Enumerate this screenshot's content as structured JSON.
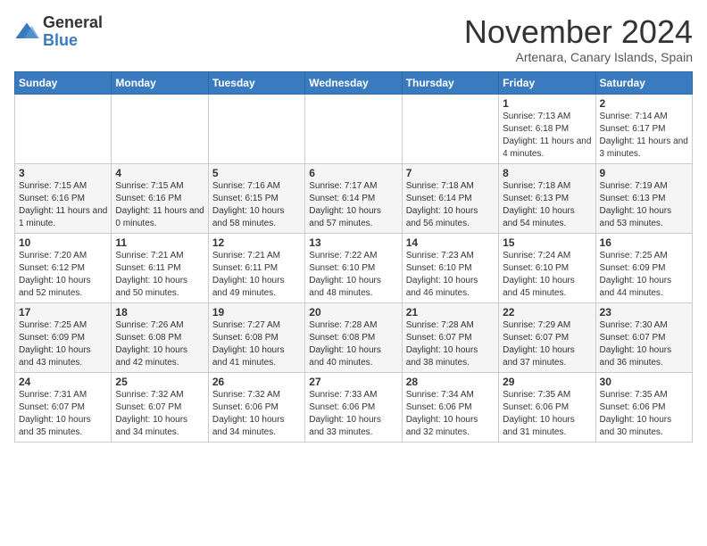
{
  "logo": {
    "general": "General",
    "blue": "Blue"
  },
  "header": {
    "month": "November 2024",
    "location": "Artenara, Canary Islands, Spain"
  },
  "weekdays": [
    "Sunday",
    "Monday",
    "Tuesday",
    "Wednesday",
    "Thursday",
    "Friday",
    "Saturday"
  ],
  "weeks": [
    [
      {
        "day": "",
        "info": ""
      },
      {
        "day": "",
        "info": ""
      },
      {
        "day": "",
        "info": ""
      },
      {
        "day": "",
        "info": ""
      },
      {
        "day": "",
        "info": ""
      },
      {
        "day": "1",
        "info": "Sunrise: 7:13 AM\nSunset: 6:18 PM\nDaylight: 11 hours and 4 minutes."
      },
      {
        "day": "2",
        "info": "Sunrise: 7:14 AM\nSunset: 6:17 PM\nDaylight: 11 hours and 3 minutes."
      }
    ],
    [
      {
        "day": "3",
        "info": "Sunrise: 7:15 AM\nSunset: 6:16 PM\nDaylight: 11 hours and 1 minute."
      },
      {
        "day": "4",
        "info": "Sunrise: 7:15 AM\nSunset: 6:16 PM\nDaylight: 11 hours and 0 minutes."
      },
      {
        "day": "5",
        "info": "Sunrise: 7:16 AM\nSunset: 6:15 PM\nDaylight: 10 hours and 58 minutes."
      },
      {
        "day": "6",
        "info": "Sunrise: 7:17 AM\nSunset: 6:14 PM\nDaylight: 10 hours and 57 minutes."
      },
      {
        "day": "7",
        "info": "Sunrise: 7:18 AM\nSunset: 6:14 PM\nDaylight: 10 hours and 56 minutes."
      },
      {
        "day": "8",
        "info": "Sunrise: 7:18 AM\nSunset: 6:13 PM\nDaylight: 10 hours and 54 minutes."
      },
      {
        "day": "9",
        "info": "Sunrise: 7:19 AM\nSunset: 6:13 PM\nDaylight: 10 hours and 53 minutes."
      }
    ],
    [
      {
        "day": "10",
        "info": "Sunrise: 7:20 AM\nSunset: 6:12 PM\nDaylight: 10 hours and 52 minutes."
      },
      {
        "day": "11",
        "info": "Sunrise: 7:21 AM\nSunset: 6:11 PM\nDaylight: 10 hours and 50 minutes."
      },
      {
        "day": "12",
        "info": "Sunrise: 7:21 AM\nSunset: 6:11 PM\nDaylight: 10 hours and 49 minutes."
      },
      {
        "day": "13",
        "info": "Sunrise: 7:22 AM\nSunset: 6:10 PM\nDaylight: 10 hours and 48 minutes."
      },
      {
        "day": "14",
        "info": "Sunrise: 7:23 AM\nSunset: 6:10 PM\nDaylight: 10 hours and 46 minutes."
      },
      {
        "day": "15",
        "info": "Sunrise: 7:24 AM\nSunset: 6:10 PM\nDaylight: 10 hours and 45 minutes."
      },
      {
        "day": "16",
        "info": "Sunrise: 7:25 AM\nSunset: 6:09 PM\nDaylight: 10 hours and 44 minutes."
      }
    ],
    [
      {
        "day": "17",
        "info": "Sunrise: 7:25 AM\nSunset: 6:09 PM\nDaylight: 10 hours and 43 minutes."
      },
      {
        "day": "18",
        "info": "Sunrise: 7:26 AM\nSunset: 6:08 PM\nDaylight: 10 hours and 42 minutes."
      },
      {
        "day": "19",
        "info": "Sunrise: 7:27 AM\nSunset: 6:08 PM\nDaylight: 10 hours and 41 minutes."
      },
      {
        "day": "20",
        "info": "Sunrise: 7:28 AM\nSunset: 6:08 PM\nDaylight: 10 hours and 40 minutes."
      },
      {
        "day": "21",
        "info": "Sunrise: 7:28 AM\nSunset: 6:07 PM\nDaylight: 10 hours and 38 minutes."
      },
      {
        "day": "22",
        "info": "Sunrise: 7:29 AM\nSunset: 6:07 PM\nDaylight: 10 hours and 37 minutes."
      },
      {
        "day": "23",
        "info": "Sunrise: 7:30 AM\nSunset: 6:07 PM\nDaylight: 10 hours and 36 minutes."
      }
    ],
    [
      {
        "day": "24",
        "info": "Sunrise: 7:31 AM\nSunset: 6:07 PM\nDaylight: 10 hours and 35 minutes."
      },
      {
        "day": "25",
        "info": "Sunrise: 7:32 AM\nSunset: 6:07 PM\nDaylight: 10 hours and 34 minutes."
      },
      {
        "day": "26",
        "info": "Sunrise: 7:32 AM\nSunset: 6:06 PM\nDaylight: 10 hours and 34 minutes."
      },
      {
        "day": "27",
        "info": "Sunrise: 7:33 AM\nSunset: 6:06 PM\nDaylight: 10 hours and 33 minutes."
      },
      {
        "day": "28",
        "info": "Sunrise: 7:34 AM\nSunset: 6:06 PM\nDaylight: 10 hours and 32 minutes."
      },
      {
        "day": "29",
        "info": "Sunrise: 7:35 AM\nSunset: 6:06 PM\nDaylight: 10 hours and 31 minutes."
      },
      {
        "day": "30",
        "info": "Sunrise: 7:35 AM\nSunset: 6:06 PM\nDaylight: 10 hours and 30 minutes."
      }
    ]
  ]
}
